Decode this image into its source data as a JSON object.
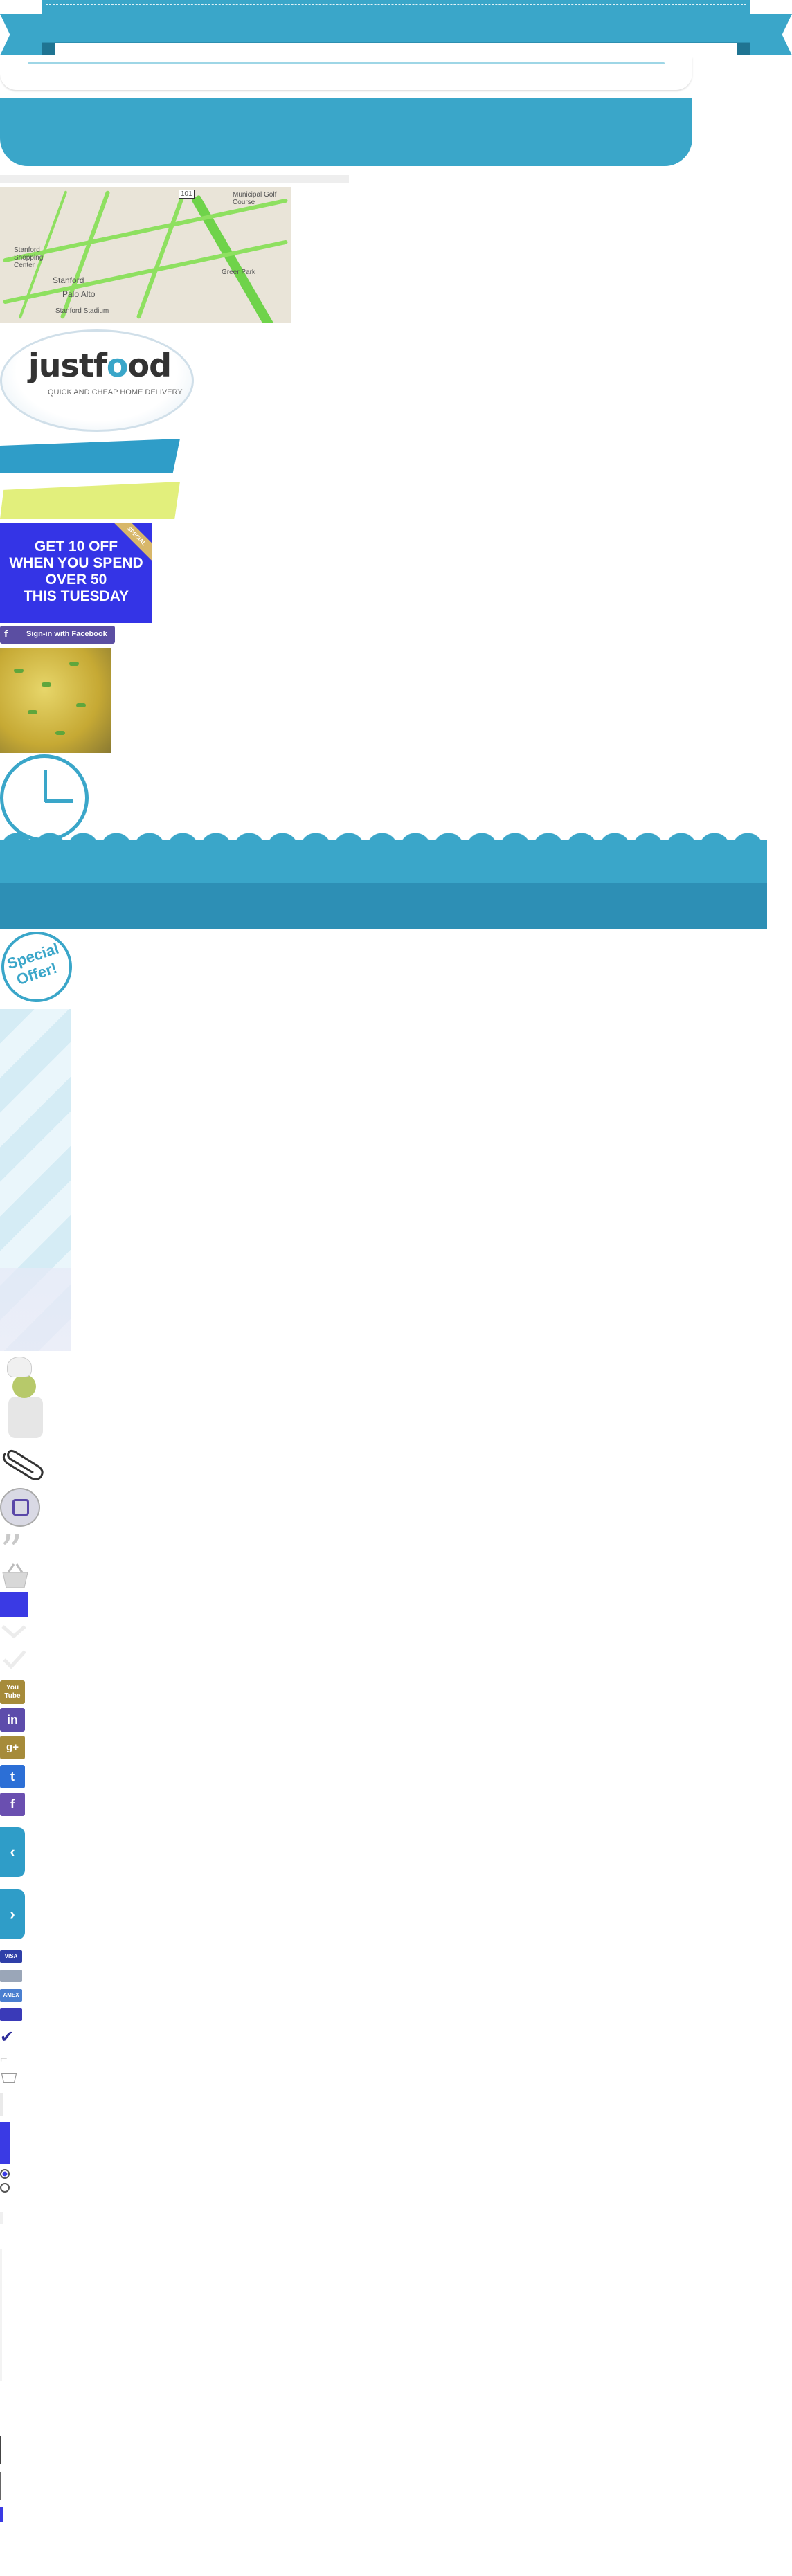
{
  "ribbon": {
    "color": "#3aa6c9"
  },
  "map": {
    "labels": [
      "Municipal Golf Course",
      "Stanford Shopping Center",
      "Stanford",
      "Palo Alto",
      "Stanford Stadium",
      "Greer Park",
      "101"
    ]
  },
  "logo": {
    "word_a": "justf",
    "word_o": "o",
    "word_b": "od",
    "tagline": "QUICK AND CHEAP HOME DELIVERY"
  },
  "promo": {
    "lines": [
      "GET 10 OFF",
      "WHEN YOU SPEND",
      "OVER 50",
      "THIS TUESDAY"
    ],
    "badge": "SPECIAL"
  },
  "facebook_button": {
    "icon": "f",
    "label": "Sign-in with Facebook"
  },
  "special_offer": {
    "line1": "Special",
    "line2": "Offer!"
  },
  "social": {
    "youtube": "You\nTube",
    "linkedin": "in",
    "googleplus": "g+",
    "twitter": "t",
    "facebook": "f"
  },
  "slider": {
    "prev": "‹",
    "next": "›"
  },
  "cards": {
    "visa": "VISA",
    "card2": "",
    "amex": "AMEX",
    "mastercard": ""
  },
  "colors": {
    "primary": "#3aa6c9",
    "accent": "#3434e6",
    "lime": "#e2ef7c"
  }
}
